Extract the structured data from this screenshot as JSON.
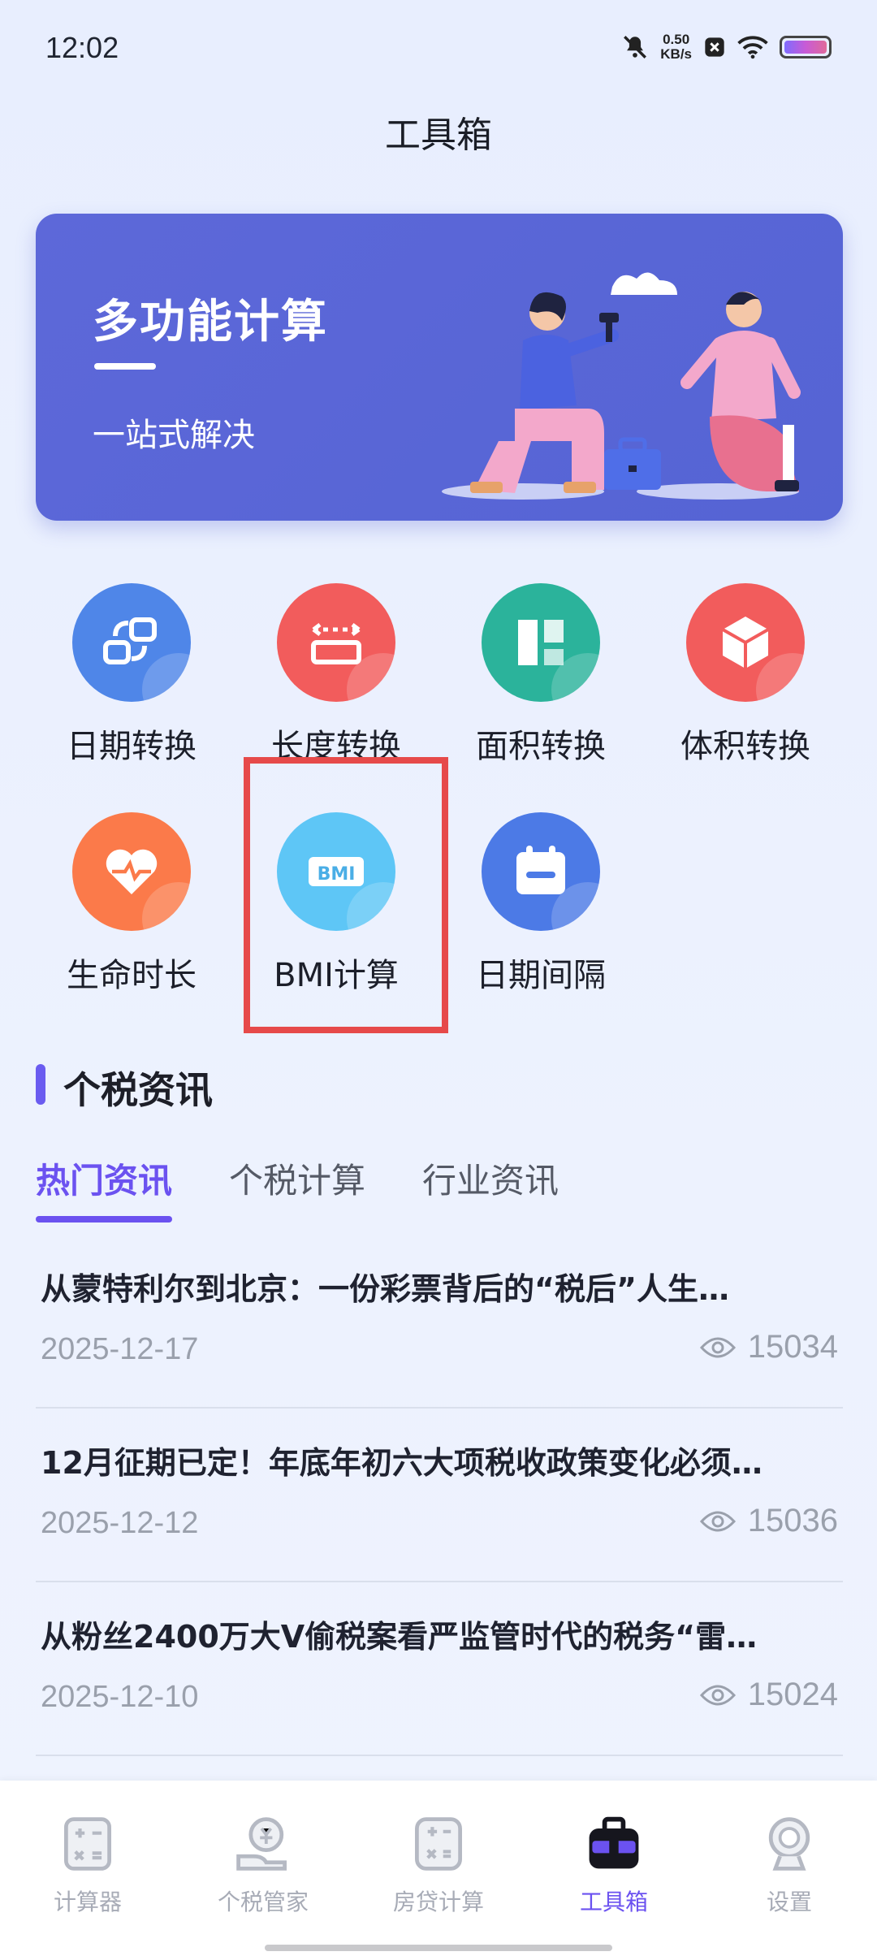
{
  "status": {
    "time": "12:02",
    "net_speed_value": "0.50",
    "net_speed_unit": "KB/s"
  },
  "header": {
    "title": "工具箱"
  },
  "banner": {
    "title": "多功能计算",
    "subtitle": "一站式解决"
  },
  "tools": [
    {
      "label": "日期转换",
      "icon": "date-convert-icon",
      "color": "#4f86e8"
    },
    {
      "label": "长度转换",
      "icon": "length-ruler-icon",
      "color": "#f25c5c"
    },
    {
      "label": "面积转换",
      "icon": "area-shapes-icon",
      "color": "#2bb39b"
    },
    {
      "label": "体积转换",
      "icon": "cube-icon",
      "color": "#f25c5c"
    },
    {
      "label": "生命时长",
      "icon": "heart-pulse-icon",
      "color": "#fb7a4a"
    },
    {
      "label": "BMI计算",
      "icon": "bmi-icon",
      "color": "#5ec6f6"
    },
    {
      "label": "日期间隔",
      "icon": "calendar-icon",
      "color": "#4c7ae6"
    }
  ],
  "section": {
    "title": "个税资讯"
  },
  "tabs": [
    {
      "label": "热门资讯",
      "active": true
    },
    {
      "label": "个税计算",
      "active": false
    },
    {
      "label": "行业资讯",
      "active": false
    }
  ],
  "news": [
    {
      "title": "从蒙特利尔到北京：一份彩票背后的“税后”人生…",
      "date": "2025-12-17",
      "views": "15034"
    },
    {
      "title": "12月征期已定！年底年初六大项税收政策变化必须…",
      "date": "2025-12-12",
      "views": "15036"
    },
    {
      "title": "从粉丝2400万大V偷税案看严监管时代的税务“雷…",
      "date": "2025-12-10",
      "views": "15024"
    }
  ],
  "bottom_nav": [
    {
      "label": "计算器",
      "icon": "calculator-icon",
      "active": false
    },
    {
      "label": "个税管家",
      "icon": "tax-manager-icon",
      "active": false
    },
    {
      "label": "房贷计算",
      "icon": "mortgage-calc-icon",
      "active": false
    },
    {
      "label": "工具箱",
      "icon": "toolbox-icon",
      "active": true
    },
    {
      "label": "设置",
      "icon": "settings-icon",
      "active": false
    }
  ],
  "colors": {
    "accent": "#6b52f0",
    "banner": "#5a67d8",
    "highlight": "#e64a4a"
  }
}
